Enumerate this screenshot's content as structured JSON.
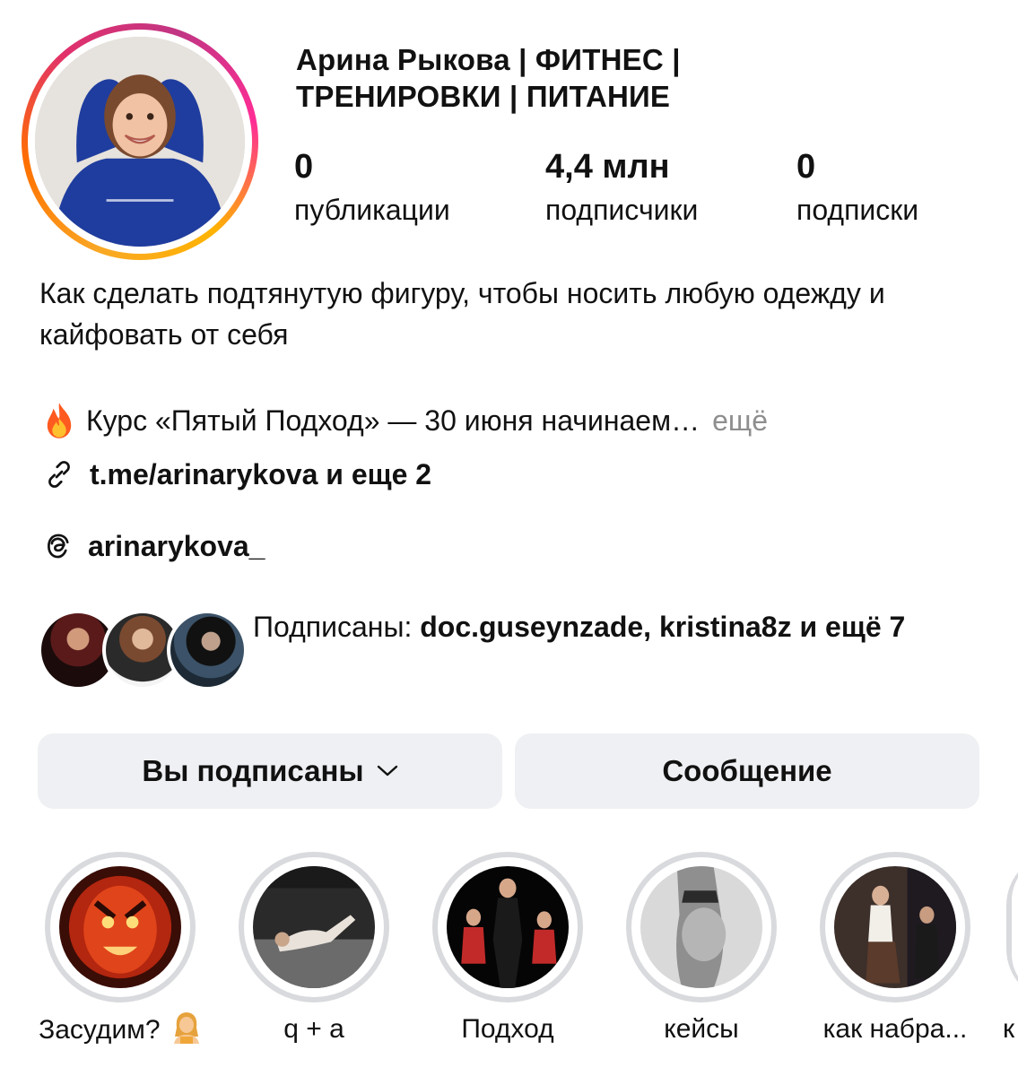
{
  "profile": {
    "name": "Арина Рыкова | ФИТНЕС | ТРЕНИРОВКИ | ПИТАНИЕ",
    "avatar_icon": "profile-photo"
  },
  "stats": {
    "posts": {
      "value": "0",
      "label": "публикации"
    },
    "followers": {
      "value": "4,4 млн",
      "label": "подписчики"
    },
    "following": {
      "value": "0",
      "label": "подписки"
    }
  },
  "bio": {
    "text": "Как сделать подтянутую фигуру, чтобы носить любую одежду и кайфовать от себя",
    "course": "Курс «Пятый Подход» — 30 июня начинаем…",
    "more": "ещё",
    "link": "t.me/arinarykova и еще 2",
    "threads": "arinarykova_"
  },
  "mutual": {
    "prefix": "Подписаны: ",
    "names": "doc.guseynzade, kristina8z",
    "suffix": " и ещё 7"
  },
  "buttons": {
    "follow": "Вы подписаны",
    "message": "Сообщение"
  },
  "highlights": [
    {
      "label": "Засудим?"
    },
    {
      "label": "q + a"
    },
    {
      "label": "Подход"
    },
    {
      "label": "кейсы"
    },
    {
      "label": "как набра..."
    },
    {
      "label": "к"
    }
  ],
  "colors": {
    "button_bg": "#eff0f3",
    "secondary_text": "#8e8e8e",
    "highlight_ring": "#d9dadd"
  }
}
